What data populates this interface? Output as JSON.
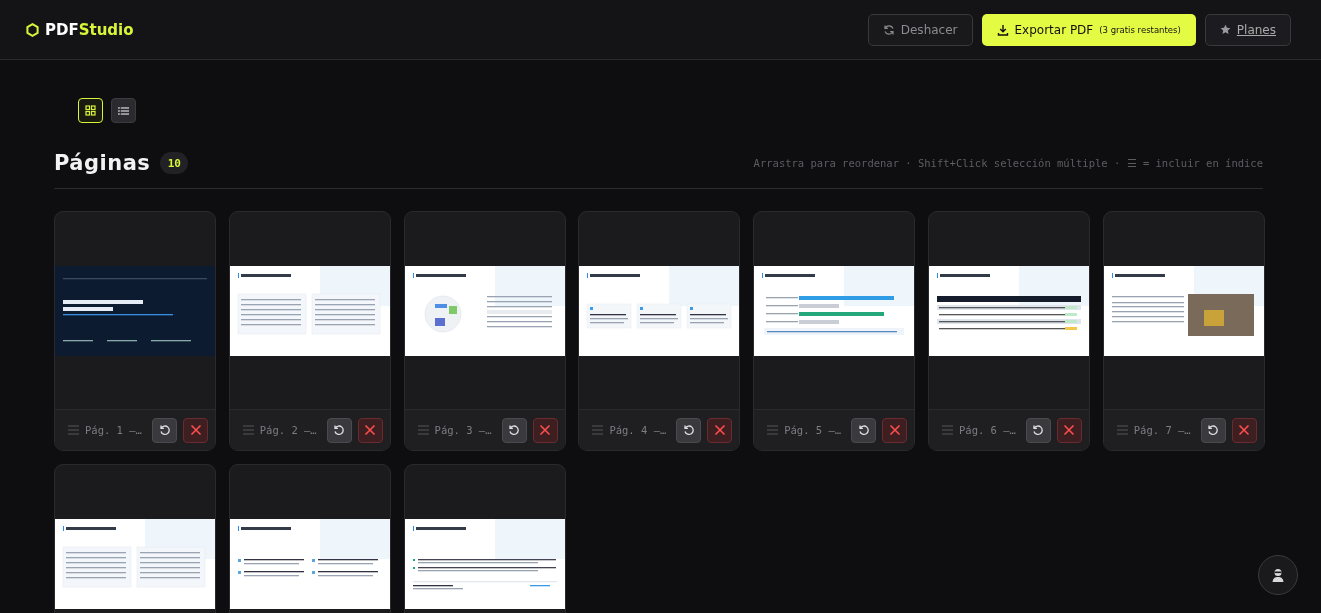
{
  "header": {
    "logo": {
      "part1": "PDF",
      "part2": "Studio"
    },
    "undo_button": {
      "label": "Deshacer"
    },
    "export_button": {
      "label": "Exportar PDF",
      "note": "(3 gratis restantes)"
    },
    "plans_link": {
      "label": "Planes"
    }
  },
  "view_toggle": [
    {
      "kind": "grid",
      "selected": true
    },
    {
      "kind": "list",
      "selected": false
    }
  ],
  "section": {
    "title": "Páginas",
    "count": "10",
    "hint": "Arrastra para reordenar · Shift+Click selección múltiple · ☰ = incluir en índice"
  },
  "pages": [
    {
      "label": "Pág. 1 —…",
      "kind": "cover"
    },
    {
      "label": "Pág. 2 —…",
      "kind": "two-cards"
    },
    {
      "label": "Pág. 3 —…",
      "kind": "image-text"
    },
    {
      "label": "Pág. 4 —…",
      "kind": "three-cards"
    },
    {
      "label": "Pág. 5 —…",
      "kind": "bars"
    },
    {
      "label": "Pág. 6 —…",
      "kind": "table"
    },
    {
      "label": "Pág. 7 —…",
      "kind": "text-photo"
    },
    {
      "kind": "two-cards"
    },
    {
      "kind": "four-items"
    },
    {
      "kind": "list"
    }
  ]
}
